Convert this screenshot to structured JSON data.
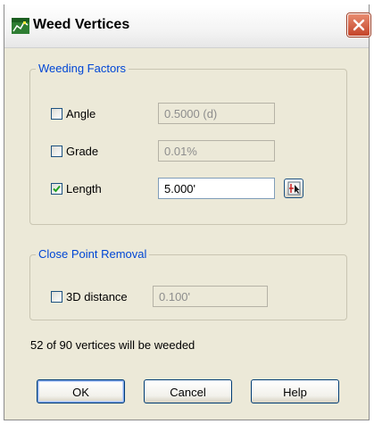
{
  "window": {
    "title": "Weed Vertices"
  },
  "weeding_factors": {
    "legend": "Weeding Factors",
    "rows": [
      {
        "label": "Angle",
        "checked": false,
        "value": "0.5000 (d)",
        "enabled": false
      },
      {
        "label": "Grade",
        "checked": false,
        "value": "0.01%",
        "enabled": false
      },
      {
        "label": "Length",
        "checked": true,
        "value": "5.000'",
        "enabled": true
      }
    ]
  },
  "close_point_removal": {
    "legend": "Close Point Removal",
    "label": "3D distance",
    "checked": false,
    "value": "0.100'",
    "enabled": false
  },
  "status": {
    "text": "52 of 90 vertices will be weeded"
  },
  "buttons": {
    "ok": "OK",
    "cancel": "Cancel",
    "help": "Help"
  },
  "colors": {
    "dialog_bg": "#ece9d8",
    "group_legend": "#0046d5",
    "close_button": "#c4452a"
  },
  "icons": {
    "app": "weed-vertices-app-icon",
    "close": "close-icon",
    "pick": "pick-in-drawing-icon",
    "check": "checkmark-icon"
  }
}
